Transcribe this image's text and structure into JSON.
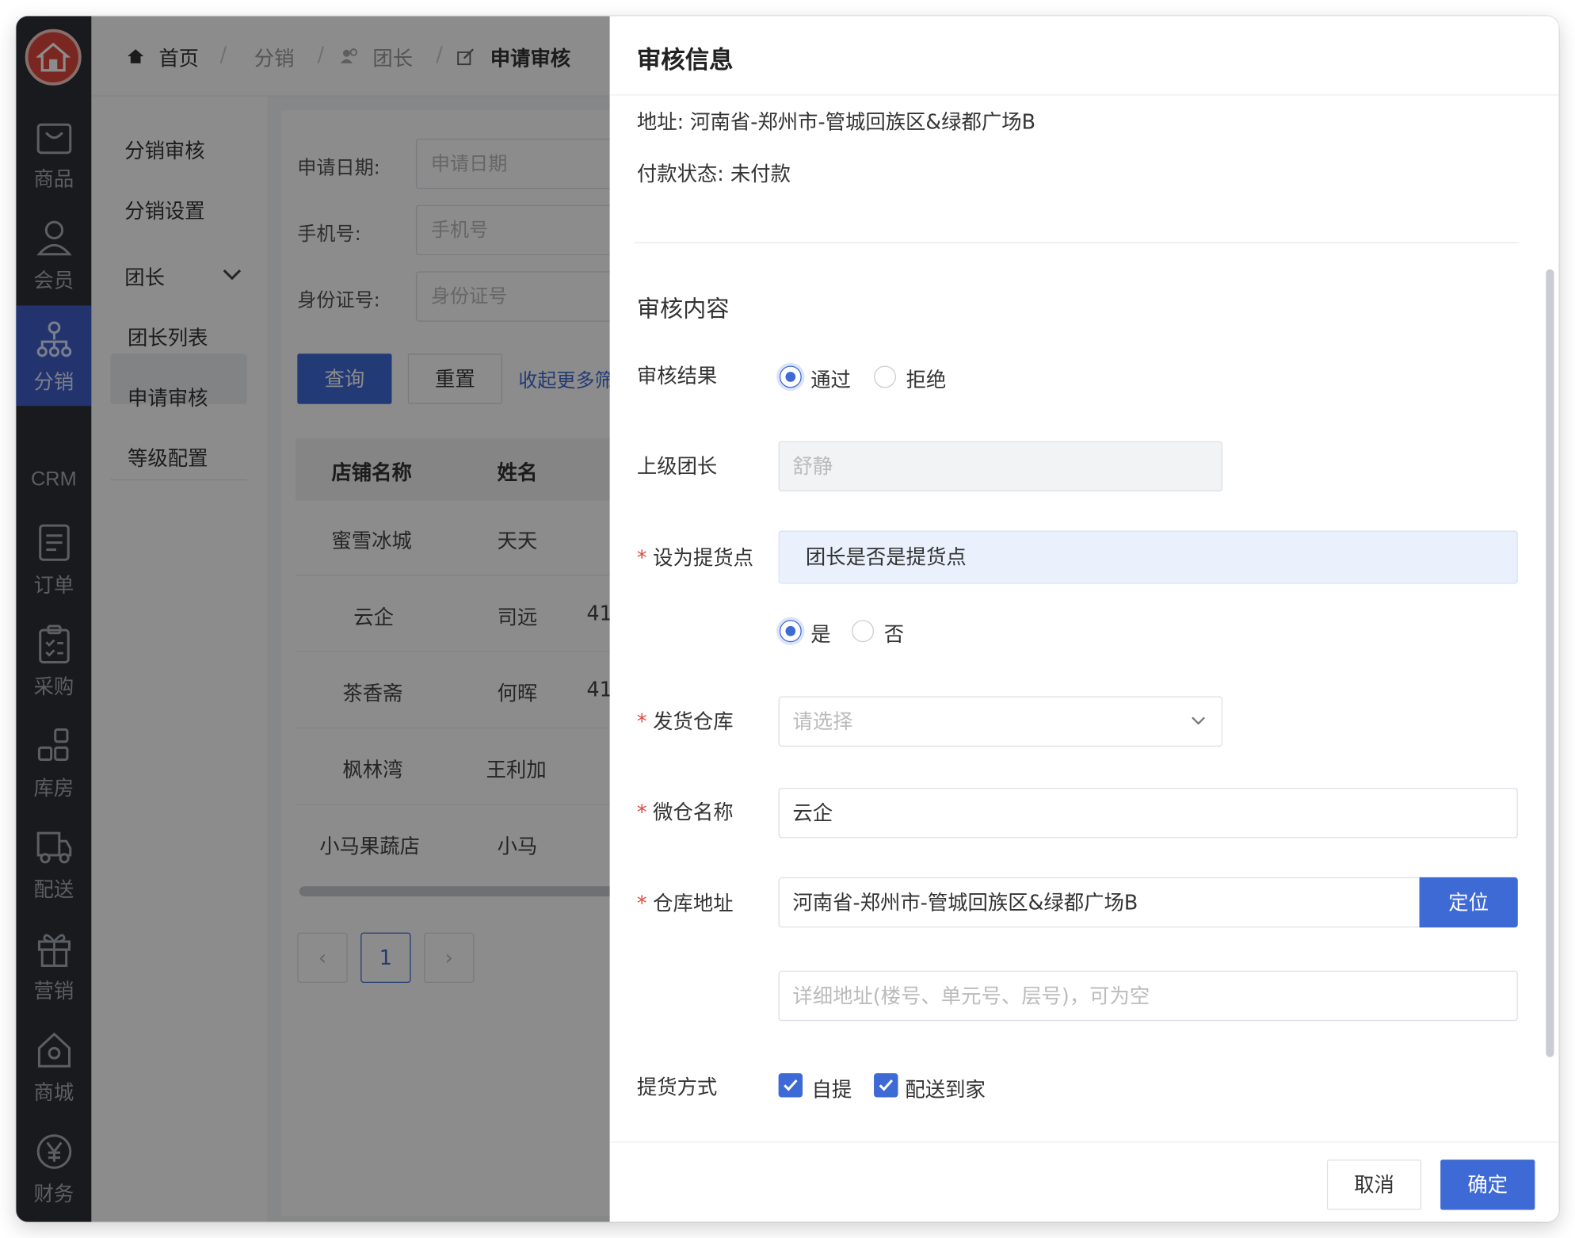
{
  "rail": {
    "items": [
      {
        "label": "商品",
        "icon": "shopping-bag-icon"
      },
      {
        "label": "会员",
        "icon": "user-icon"
      },
      {
        "label": "分销",
        "icon": "distribution-tree-icon",
        "active": true
      },
      {
        "label": "订单",
        "icon": "order-document-icon"
      },
      {
        "label": "采购",
        "icon": "purchase-clipboard-icon"
      },
      {
        "label": "库房",
        "icon": "warehouse-blocks-icon"
      },
      {
        "label": "配送",
        "icon": "delivery-truck-icon"
      },
      {
        "label": "营销",
        "icon": "gift-icon"
      },
      {
        "label": "商城",
        "icon": "store-home-icon"
      },
      {
        "label": "财务",
        "icon": "yen-coin-icon"
      }
    ],
    "crm_label": "CRM"
  },
  "breadcrumb": {
    "home": "首页",
    "level1": "分销",
    "level2": "团长",
    "current": "申请审核"
  },
  "subnav": {
    "items": [
      "分销审核",
      "分销设置",
      "团长",
      "团长列表",
      "申请审核",
      "等级配置"
    ],
    "collapse_label": "收起"
  },
  "filters": {
    "date_label": "申请日期:",
    "date_placeholder": "申请日期",
    "phone_label": "手机号:",
    "phone_placeholder": "手机号",
    "id_label": "身份证号:",
    "id_placeholder": "身份证号",
    "query_label": "查询",
    "reset_label": "重置",
    "more_label": "收起更多筛"
  },
  "table": {
    "headers": [
      "店铺名称",
      "姓名"
    ],
    "rows": [
      {
        "shop": "蜜雪冰城",
        "name": "天天",
        "extra": ""
      },
      {
        "shop": "云企",
        "name": "司远",
        "extra": "41"
      },
      {
        "shop": "茶香斋",
        "name": "何晖",
        "extra": "41"
      },
      {
        "shop": "枫林湾",
        "name": "王利加",
        "extra": ""
      },
      {
        "shop": "小马果蔬店",
        "name": "小马",
        "extra": ""
      }
    ]
  },
  "pagination": {
    "prev": "‹",
    "current": "1",
    "next": "›"
  },
  "drawer": {
    "title": "审核信息",
    "address": "地址: 河南省-郑州市-管城回族区&绿都广场B",
    "payment": "付款状态: 未付款",
    "section": "审核内容",
    "result_label": "审核结果",
    "result_pass": "通过",
    "result_reject": "拒绝",
    "leader_label": "上级团长",
    "leader_value": "舒静",
    "pickup_label": "设为提货点",
    "pickup_notice": "团长是否是提货点",
    "pickup_yes": "是",
    "pickup_no": "否",
    "warehouse_label": "发货仓库",
    "warehouse_placeholder": "请选择",
    "micro_label": "微仓名称",
    "micro_value": "云企",
    "addr_label": "仓库地址",
    "addr_value": "河南省-郑州市-管城回族区&绿都广场B",
    "locate_label": "定位",
    "detail_placeholder": "详细地址(楼号、单元号、层号)，可为空",
    "method_label": "提货方式",
    "method_self": "自提",
    "method_delivery": "配送到家",
    "cancel_label": "取消",
    "confirm_label": "确定"
  },
  "colors": {
    "accent": "#3e6ad6",
    "rail": "#2c3138",
    "required": "#e0473d"
  }
}
